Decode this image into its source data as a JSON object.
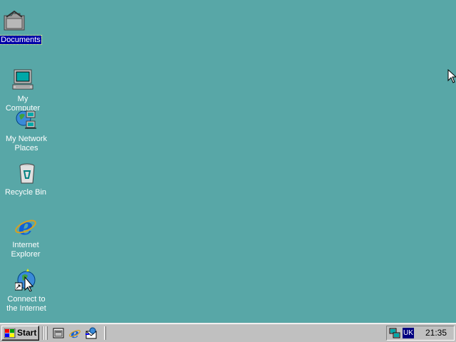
{
  "desktop": {
    "background_color": "#58a7a7",
    "icons": [
      {
        "name": "documents",
        "label": "Documents",
        "icon": "folder-icon",
        "selected": true
      },
      {
        "name": "my-computer",
        "label": "My Computer",
        "icon": "computer-icon"
      },
      {
        "name": "my-network-places",
        "label": "My Network\nPlaces",
        "icon": "network-icon"
      },
      {
        "name": "recycle-bin",
        "label": "Recycle Bin",
        "icon": "recycle-bin-icon"
      },
      {
        "name": "internet-explorer",
        "label": "Internet\nExplorer",
        "icon": "ie-icon"
      },
      {
        "name": "connect-to-internet",
        "label": "Connect to\nthe Internet",
        "icon": "connect-wizard-icon"
      }
    ]
  },
  "taskbar": {
    "start_label": "Start",
    "quick_launch": [
      "show-desktop-icon",
      "ie-icon",
      "outlook-express-icon"
    ],
    "tray": {
      "icons": [
        "network-status-icon"
      ],
      "language": "UK",
      "clock": "21:35"
    }
  },
  "colors": {
    "selection": "#0000a8",
    "taskbar": "#c0c0c0",
    "lang_badge": "#000080"
  }
}
